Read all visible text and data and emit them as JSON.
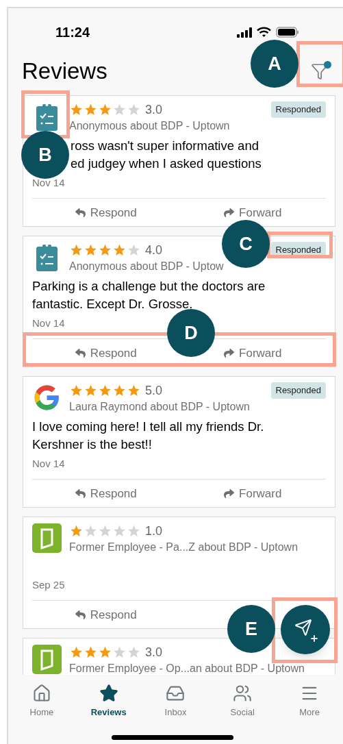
{
  "status_bar": {
    "time": "11:24"
  },
  "title": "Reviews",
  "filter": {
    "active": true
  },
  "reviews": [
    {
      "kind": "clipboard",
      "stars": 3,
      "rating": "3.0",
      "badge": "Responded",
      "author": "Anonymous about BDP - Uptown",
      "body_lines": [
        "ross wasn't super informative and",
        "ed judgey when I asked questions"
      ],
      "date": "Nov 14",
      "actions": [
        {
          "kind": "respond",
          "label": "Respond"
        },
        {
          "kind": "forward",
          "label": "Forward"
        }
      ]
    },
    {
      "kind": "clipboard",
      "stars": 4,
      "rating": "4.0",
      "badge": "Responded",
      "author": "Anonymous about BDP - Uptow",
      "body_lines": [
        "Parking is a challenge but the doctors are",
        "fantastic. Except Dr. Grosse."
      ],
      "date": "Nov 14",
      "actions": [
        {
          "kind": "respond",
          "label": "Respond"
        },
        {
          "kind": "forward",
          "label": "Forward"
        }
      ]
    },
    {
      "kind": "google",
      "stars": 5,
      "rating": "5.0",
      "badge": "Responded",
      "author": "Laura Raymond about BDP - Uptown",
      "body_lines": [
        "I love coming here! I tell all my friends Dr.",
        "Kershner is the best!!"
      ],
      "date": "Nov 14",
      "actions": [
        {
          "kind": "respond",
          "label": "Respond"
        },
        {
          "kind": "forward",
          "label": "Forward"
        }
      ]
    },
    {
      "kind": "door",
      "stars": 1,
      "rating": "1.0",
      "author": "Former Employee - Pa...Z about BDP - Uptown",
      "date": "Sep 25",
      "actions": [
        {
          "kind": "respond",
          "label": "Respond"
        }
      ]
    },
    {
      "kind": "door",
      "stars": 3,
      "rating": "3.0",
      "author": "Former Employee - Op...an about BDP - Uptown"
    }
  ],
  "nav": [
    {
      "label": "Home",
      "selected": false
    },
    {
      "label": "Reviews",
      "selected": true
    },
    {
      "label": "Inbox",
      "selected": false
    },
    {
      "label": "Social",
      "selected": false
    },
    {
      "label": "More",
      "selected": false
    }
  ],
  "callouts": [
    {
      "label": "A"
    },
    {
      "label": "B"
    },
    {
      "label": "C"
    },
    {
      "label": "D"
    },
    {
      "label": "E"
    }
  ]
}
